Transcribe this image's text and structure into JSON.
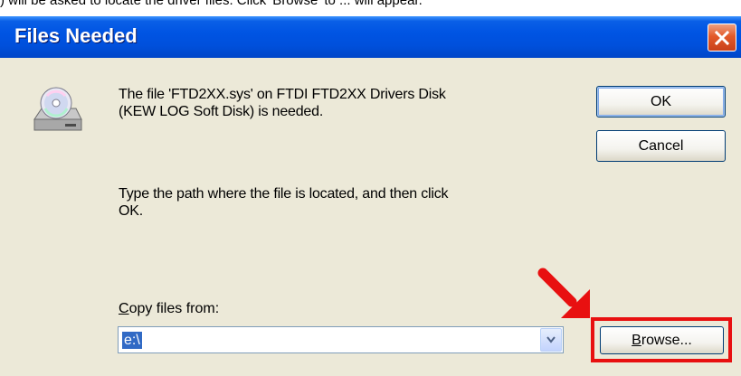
{
  "top_caption": ") will be asked to locate the driver files. Click 'Browse' to ... will appear.",
  "dialog": {
    "title": "Files Needed",
    "message_line1": "The file 'FTD2XX.sys' on FTDI FTD2XX Drivers Disk",
    "message_line2": "(KEW LOG Soft Disk) is needed.",
    "instruction_line1": "Type the path where the file is located, and then click",
    "instruction_line2": "OK.",
    "copy_from_label_access": "C",
    "copy_from_label_rest": "opy files from:",
    "copy_from_value": "e:\\",
    "ok_label": "OK",
    "cancel_label": "Cancel",
    "browse_access": "B",
    "browse_rest": "rowse..."
  },
  "colors": {
    "titlebar": "#0054e3",
    "dialog_bg": "#ece9d8",
    "annotation_red": "#e81010",
    "selection": "#316ac5"
  },
  "icons": [
    "close-icon",
    "disk-drive-icon",
    "chevron-down-icon",
    "red-arrow-annotation"
  ]
}
